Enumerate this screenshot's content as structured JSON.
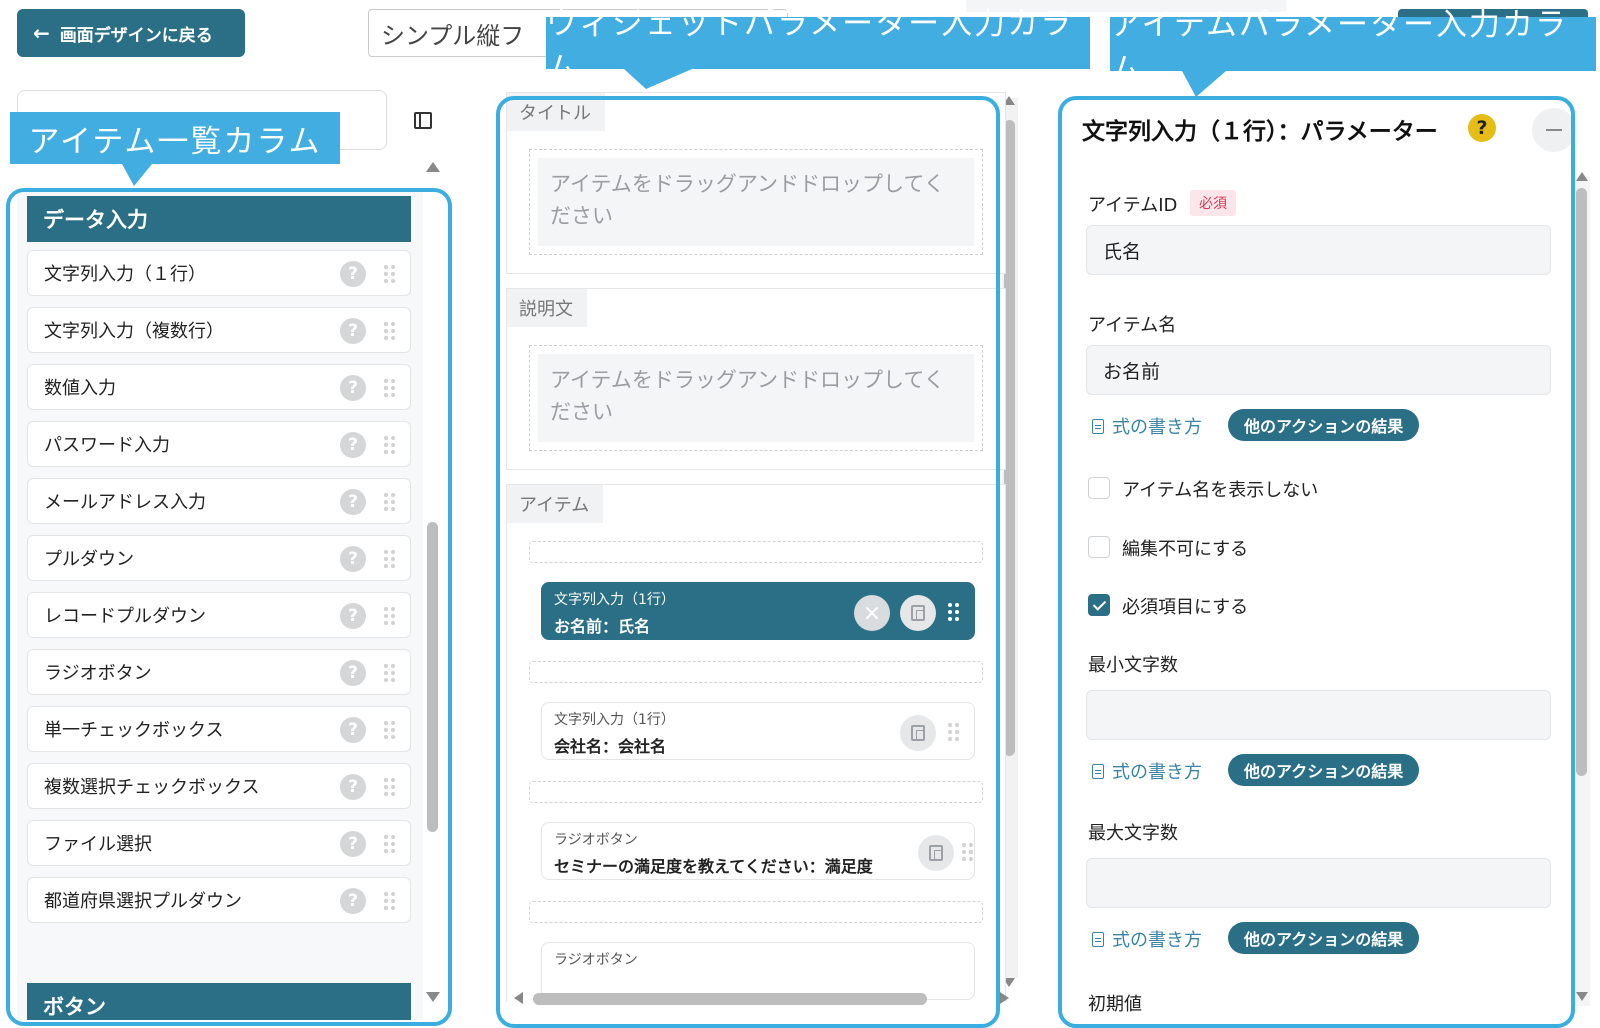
{
  "header": {
    "back_label": "画面デザインに戻る",
    "back_icon": "arrow-left-icon",
    "form_title": "シンプル縦フ"
  },
  "callouts": {
    "item_list": "アイテム一覧カラム",
    "widget_params": "ウィジェットパラメーター入力カラム",
    "item_params": "アイテムパラメーター入力カラム"
  },
  "left": {
    "category": "データ入力",
    "category2": "ボタン",
    "help_glyph": "?",
    "items": [
      "文字列入力（１行）",
      "文字列入力（複数行）",
      "数値入力",
      "パスワード入力",
      "メールアドレス入力",
      "プルダウン",
      "レコードプルダウン",
      "ラジオボタン",
      "単一チェックボックス",
      "複数選択チェックボックス",
      "ファイル選択",
      "都道府県選択プルダウン"
    ]
  },
  "middle": {
    "title_label": "タイトル",
    "desc_label": "説明文",
    "items_label": "アイテム",
    "dropzone_text": "アイテムをドラッグアンドドロップしてください",
    "widgets": [
      {
        "type": "文字列入力（1行）",
        "name": "お名前：氏名",
        "selected": true
      },
      {
        "type": "文字列入力（1行）",
        "name": "会社名：会社名",
        "selected": false
      },
      {
        "type": "ラジオボタン",
        "name": "セミナーの満足度を教えてください：満足度",
        "selected": false
      },
      {
        "type": "ラジオボタン",
        "name": "",
        "selected": false
      }
    ]
  },
  "right": {
    "title": "文字列入力（１行）：パラメーター",
    "help_glyph": "?",
    "item_id_label": "アイテムID",
    "required_badge": "必須",
    "item_id_value": "氏名",
    "item_name_label": "アイテム名",
    "item_name_value": "お名前",
    "formula_link": "式の書き方",
    "action_pill": "他のアクションの結果",
    "hide_name_label": "アイテム名を表示しない",
    "readonly_label": "編集不可にする",
    "required_label": "必須項目にする",
    "hide_name_checked": false,
    "readonly_checked": false,
    "required_checked": true,
    "min_len_label": "最小文字数",
    "min_len_value": "",
    "max_len_label": "最大文字数",
    "max_len_value": "",
    "default_label": "初期値"
  },
  "colors": {
    "primary": "#2a6f86",
    "callout": "#41ade0",
    "outline": "#3aaee0",
    "help_yellow": "#e6bd16",
    "required_red": "#d23b58"
  }
}
